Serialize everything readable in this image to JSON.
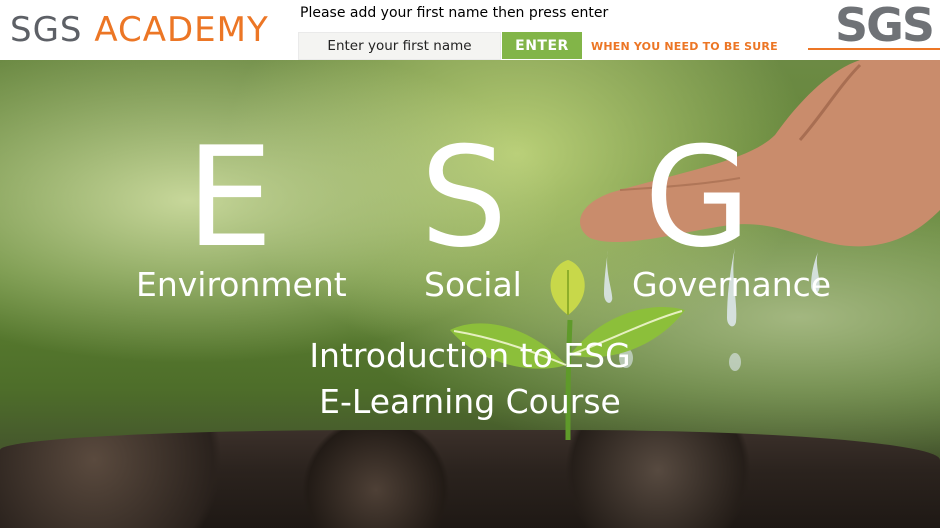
{
  "header": {
    "brand_sgs": "SGS",
    "brand_academy": "ACADEMY",
    "prompt": "Please add your first name then press enter",
    "name_placeholder": "Enter your first name",
    "enter_label": "ENTER",
    "tagline": "WHEN YOU NEED TO BE SURE",
    "logo": "SGS"
  },
  "hero": {
    "letters": [
      "E",
      "S",
      "G"
    ],
    "words": [
      "Environment",
      "Social",
      "Governance"
    ],
    "course_line1": "Introduction to ESG",
    "course_line2": "E-Learning Course"
  },
  "colors": {
    "accent_orange": "#ec7625",
    "enter_green": "#82b548",
    "logo_gray": "#6f7276"
  }
}
